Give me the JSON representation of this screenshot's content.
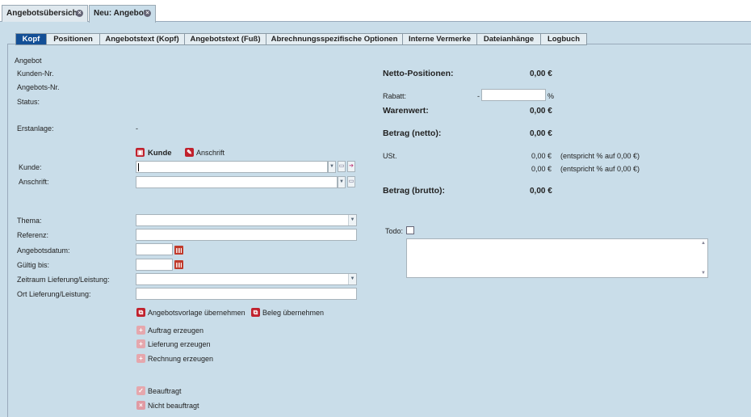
{
  "doc_tabs": [
    {
      "label": "Angebotsübersicht"
    },
    {
      "label": "Neu: Angebot"
    }
  ],
  "subtabs": [
    "Kopf",
    "Positionen",
    "Angebotstext (Kopf)",
    "Angebotstext (Fuß)",
    "Abrechnungsspezifische Optionen",
    "Interne Vermerke",
    "Dateianhänge",
    "Logbuch"
  ],
  "header": {
    "angebot": "Angebot",
    "kunden_nr": "Kunden-Nr.",
    "angebots_nr": "Angebots-Nr.",
    "status": "Status:",
    "erstanlage": "Erstanlage:",
    "erstanlage_value": "-"
  },
  "toggle": {
    "kunde": "Kunde",
    "anschrift": "Anschrift"
  },
  "fields": {
    "kunde": "Kunde:",
    "anschrift": "Anschrift:",
    "thema": "Thema:",
    "referenz": "Referenz:",
    "angebotsdatum": "Angebotsdatum:",
    "gueltig_bis": "Gültig bis:",
    "zeitraum": "Zeitraum Lieferung/Leistung:",
    "ort": "Ort Lieferung/Leistung:"
  },
  "actions": {
    "vorlage": "Angebotsvorlage übernehmen",
    "beleg": "Beleg übernehmen",
    "auftrag": "Auftrag erzeugen",
    "lieferung": "Lieferung erzeugen",
    "rechnung": "Rechnung erzeugen",
    "beauftragt": "Beauftragt",
    "nicht_beauftragt": "Nicht beauftragt"
  },
  "totals": {
    "netto_label": "Netto-Positionen:",
    "netto_value": "0,00 €",
    "rabatt_label": "Rabatt:",
    "rabatt_prefix": "-",
    "rabatt_unit": "%",
    "warenwert_label": "Warenwert:",
    "warenwert_value": "0,00 €",
    "betrag_netto_label": "Betrag (netto):",
    "betrag_netto_value": "0,00 €",
    "ust_label": "USt.",
    "ust_value_1": "0,00 €",
    "ust_note_1": "(entspricht % auf 0,00 €)",
    "ust_value_2": "0,00 €",
    "ust_note_2": "(entspricht % auf 0,00 €)",
    "betrag_brutto_label": "Betrag (brutto):",
    "betrag_brutto_value": "0,00 €"
  },
  "todo": {
    "label": "Todo:"
  },
  "icons": {
    "tab_close": "close-icon",
    "calendar": "calendar-icon",
    "dropdown": "chevron-down-icon"
  }
}
